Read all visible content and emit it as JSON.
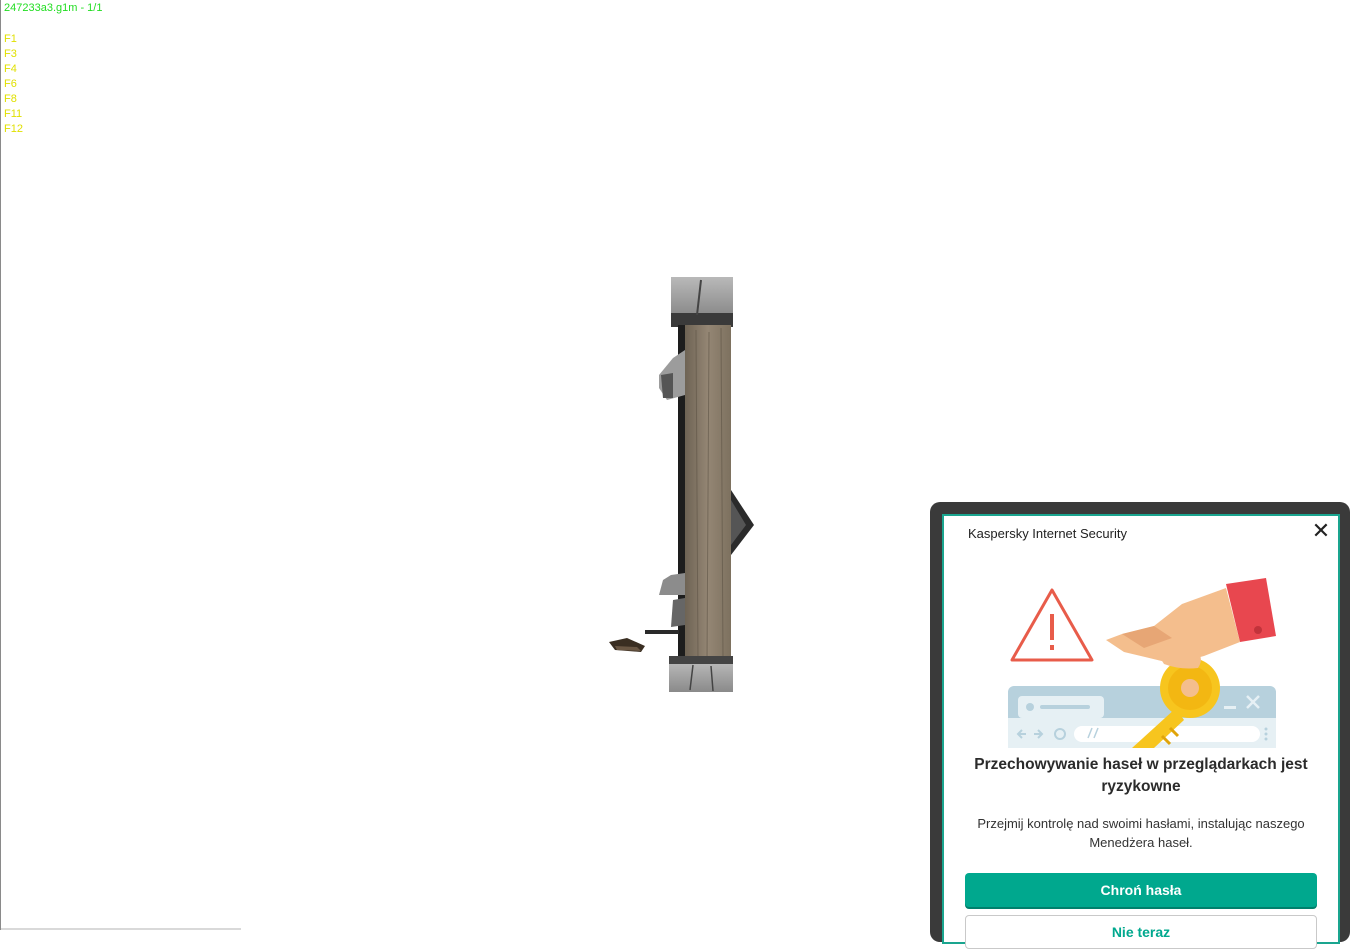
{
  "viewer": {
    "title": "247233a3.g1m - 1/1",
    "hotkeys": [
      "F1",
      "F3",
      "F4",
      "F6",
      "F8",
      "F11",
      "F12"
    ],
    "colors": {
      "title": "#22dd22",
      "hotkeys": "#e0e000",
      "background": "#ffffff"
    }
  },
  "kaspersky": {
    "app_title": "Kaspersky Internet Security",
    "close_icon": "close-icon",
    "heading": "Przechowywanie haseł w przeglądarkach jest ryzykowne",
    "body": "Przejmij kontrolę nad swoimi hasłami, instalując naszego Menedżera haseł.",
    "primary_button": "Chroń hasła",
    "secondary_button": "Nie teraz",
    "colors": {
      "accent": "#00a88e",
      "frame": "#3a3a3a"
    }
  }
}
